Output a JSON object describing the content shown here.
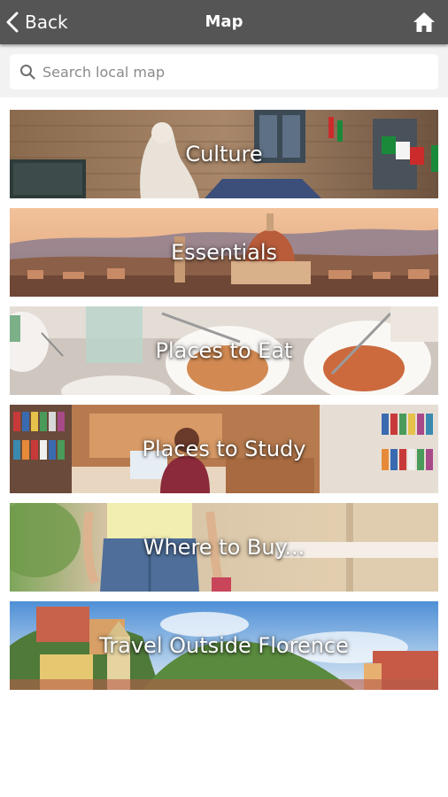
{
  "header": {
    "back_label": "Back",
    "title": "Map",
    "icons": {
      "back": "chevron-left-icon",
      "home": "home-icon"
    }
  },
  "search": {
    "placeholder": "Search local map",
    "value": "",
    "icon": "search-icon"
  },
  "categories": [
    {
      "label": "Culture"
    },
    {
      "label": "Essentials"
    },
    {
      "label": "Places to Eat"
    },
    {
      "label": "Places to Study"
    },
    {
      "label": "Where to Buy..."
    },
    {
      "label": "Travel Outside Florence"
    }
  ],
  "colors": {
    "nav_bar": "#555555",
    "search_band": "#f2f2f2",
    "caption_text": "#ffffff"
  }
}
